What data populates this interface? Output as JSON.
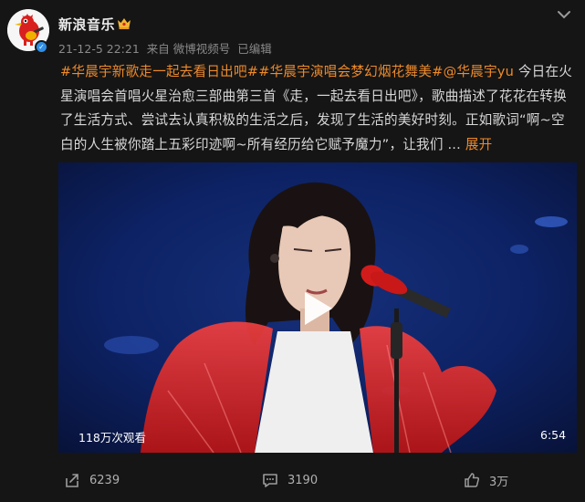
{
  "user": {
    "name": "新浪音乐",
    "verified": true
  },
  "post": {
    "date": "21-12-5 22:21",
    "source": "来自 微博视频号",
    "edited": "已编辑",
    "tags": [
      "#华晨宇新歌走一起去看日出吧#",
      "#华晨宇演唱会梦幻烟花舞美#",
      "@华晨宇yu"
    ],
    "text": " 今日在火星演唱会首唱火星治愈三部曲第三首《走，一起去看日出吧》，歌曲描述了花花在转换了生活方式、尝试去认真积极的生活之后，发现了生活的美好时刻。正如歌词“啊~空白的人生被你踏上五彩印迹啊~所有经历给它赋予魔力”，让我们 ",
    "ellipsis": "...",
    "expand_label": "展开"
  },
  "video": {
    "views": "118万次观看",
    "duration": "6:54"
  },
  "actions": {
    "reposts": "6239",
    "comments": "3190",
    "likes": "3万"
  },
  "colors": {
    "accent": "#ee8a2a",
    "background": "#151515",
    "verify": "#2f8fe7"
  }
}
